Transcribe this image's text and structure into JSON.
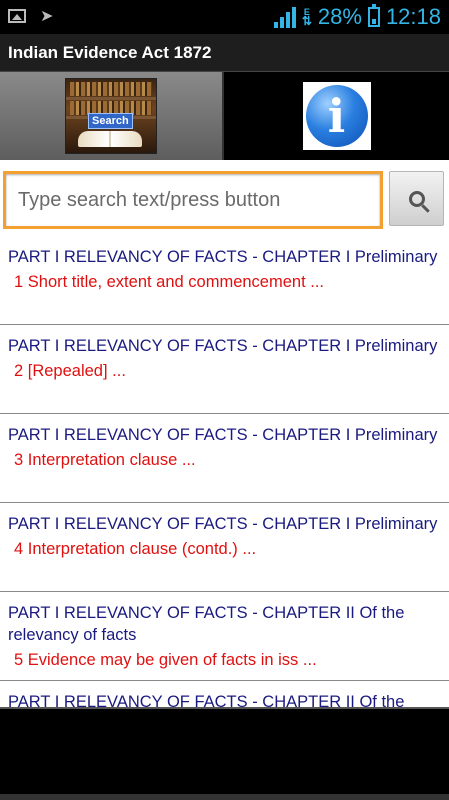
{
  "status_bar": {
    "battery": "28%",
    "time": "12:18",
    "network_type": "E",
    "icons": [
      "image-icon",
      "arrow-icon",
      "signal-icon",
      "data-icon",
      "battery-icon"
    ]
  },
  "app": {
    "title": "Indian Evidence Act 1872"
  },
  "tabs": {
    "search_label": "Search",
    "info_glyph": "i"
  },
  "search": {
    "placeholder": "Type search text/press button"
  },
  "list": [
    {
      "title": "PART I RELEVANCY OF FACTS - CHAPTER I Preliminary",
      "subtitle": "1 Short title, extent and commencement ..."
    },
    {
      "title": "PART I RELEVANCY OF FACTS - CHAPTER I Preliminary",
      "subtitle": "2 [Repealed] ..."
    },
    {
      "title": "PART I RELEVANCY OF FACTS - CHAPTER I Preliminary",
      "subtitle": "3 Interpretation clause ..."
    },
    {
      "title": "PART I RELEVANCY OF FACTS - CHAPTER I Preliminary",
      "subtitle": "4 Interpretation clause (contd.) ..."
    },
    {
      "title": "PART I RELEVANCY OF FACTS - CHAPTER II Of the relevancy of facts",
      "subtitle": "5 Evidence may be given of facts in iss ..."
    },
    {
      "title": "PART I RELEVANCY OF FACTS - CHAPTER II Of the",
      "subtitle": ""
    }
  ],
  "colors": {
    "accent_orange": "#f2a131",
    "title_blue": "#1a1a80",
    "subtitle_red": "#e01010",
    "status_blue": "#33b5e5"
  }
}
